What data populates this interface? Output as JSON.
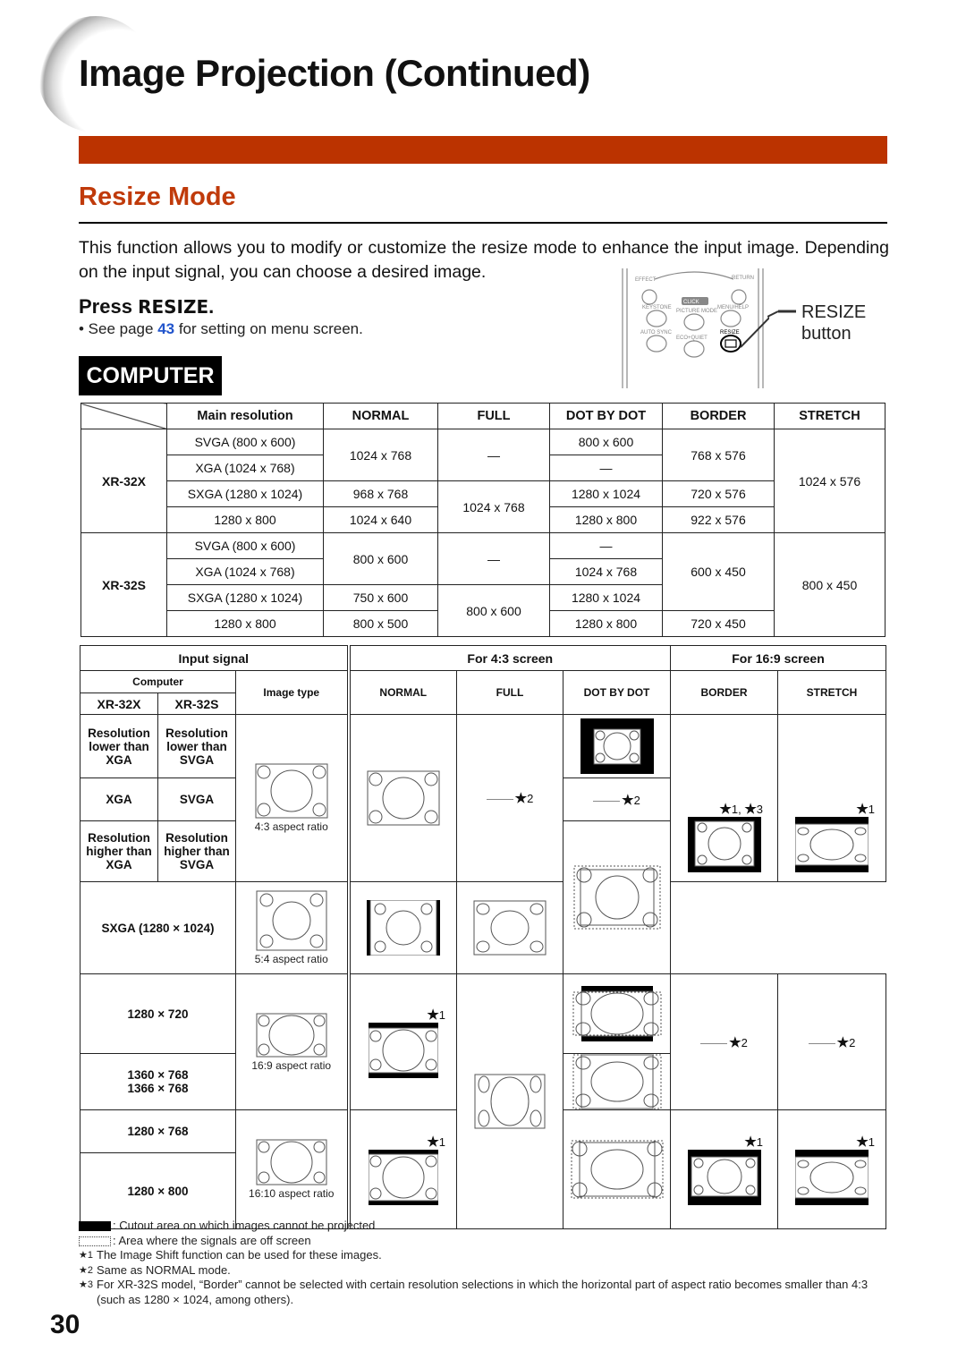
{
  "header": {
    "title": "Image Projection (Continued)",
    "accent_color": "#bb3300",
    "section_color": "#c03a0a"
  },
  "section": {
    "title": "Resize Mode",
    "intro": "This function allows you to modify or customize the resize mode to enhance the input image. Depending on the input signal, you can choose a desired image.",
    "press_prefix": "Press ",
    "press_key": "RESIZE",
    "press_suffix": ".",
    "see_prefix": "• See page ",
    "see_page": "43",
    "see_suffix": " for setting on menu screen.",
    "badge": "COMPUTER"
  },
  "remote": {
    "labels": [
      "EFFECT",
      "RETURN",
      "KEYSTONE",
      "CLICK",
      "PICTURE MODE",
      "MENU/HELP",
      "AUTO SYNC",
      "ECO+QUIET",
      "RESIZE"
    ],
    "callout_line1": "RESIZE",
    "callout_line2": "button"
  },
  "resolution_table": {
    "headers": [
      "",
      "Main resolution",
      "NORMAL",
      "FULL",
      "DOT BY DOT",
      "BORDER",
      "STRETCH"
    ],
    "groups": [
      {
        "model": "XR-32X",
        "rows": [
          {
            "main": "SVGA (800 x 600)",
            "normal": "1024 x 768",
            "full": "—",
            "dot": "800 x 600",
            "border": "768 x 576",
            "stretch": "1024 x 576"
          },
          {
            "main": "XGA (1024 x 768)",
            "normal": "1024 x 768",
            "full": "—",
            "dot": "—",
            "border": "768 x 576",
            "stretch": "1024 x 576"
          },
          {
            "main": "SXGA (1280 x 1024)",
            "normal": "968 x 768",
            "full": "1024 x 768",
            "dot": "1280 x 1024",
            "border": "720 x 576",
            "stretch": "1024 x 576"
          },
          {
            "main": "1280 x 800",
            "normal": "1024 x 640",
            "full": "1024 x 768",
            "dot": "1280 x 800",
            "border": "922 x 576",
            "stretch": "1024 x 576"
          }
        ]
      },
      {
        "model": "XR-32S",
        "rows": [
          {
            "main": "SVGA (800 x 600)",
            "normal": "800 x 600",
            "full": "—",
            "dot": "—",
            "border": "600 x 450",
            "stretch": "800 x 450"
          },
          {
            "main": "XGA (1024 x 768)",
            "normal": "800 x 600",
            "full": "—",
            "dot": "1024 x 768",
            "border": "600 x 450",
            "stretch": "800 x 450"
          },
          {
            "main": "SXGA (1280 x 1024)",
            "normal": "750 x 600",
            "full": "800 x 600",
            "dot": "1280 x 1024",
            "border": "600 x 450",
            "stretch": "800 x 450"
          },
          {
            "main": "1280 x 800",
            "normal": "800 x 500",
            "full": "800 x 600",
            "dot": "1280 x 800",
            "border": "720 x 450",
            "stretch": "800 x 450"
          }
        ]
      }
    ]
  },
  "image_table": {
    "input_signal": "Input signal",
    "computer": "Computer",
    "model_x": "XR-32X",
    "model_s": "XR-32S",
    "image_type": "Image type",
    "screen_43": "For 4:3 screen",
    "screen_169": "For 16:9 screen",
    "modes": [
      "NORMAL",
      "FULL",
      "DOT BY DOT",
      "BORDER",
      "STRETCH"
    ],
    "rows": {
      "lower_x": "Resolution lower than XGA",
      "lower_s": "Resolution lower than SVGA",
      "eq_x": "XGA",
      "eq_s": "SVGA",
      "higher_x": "Resolution higher than XGA",
      "higher_s": "Resolution higher than SVGA",
      "sxga": "SXGA (1280 × 1024)",
      "r720": "1280 × 720",
      "r1360": "1360 × 768",
      "r1366": "1366 × 768",
      "r768": "1280 × 768",
      "r800": "1280 × 800"
    },
    "captions": {
      "a43": "4:3 aspect ratio",
      "a54": "5:4 aspect ratio",
      "a169": "16:9 aspect ratio",
      "a1610": "16:10 aspect ratio"
    },
    "notes": {
      "star": "★",
      "n1": "1",
      "n2": "2",
      "n13": "1, ",
      "n3": "3"
    }
  },
  "legend": {
    "cutout": ": Cutout area on which images cannot be projected",
    "offscreen": ": Area where the signals are off screen",
    "fn1_mark": "★1",
    "fn1": "The Image Shift function can be used for these images.",
    "fn2_mark": "★2",
    "fn2": "Same as NORMAL mode.",
    "fn3_mark": "★3",
    "fn3": "For XR-32S model, “Border” cannot be selected with certain resolution selections in which the horizontal part of aspect ratio becomes smaller than 4:3 (such as 1280 × 1024, among others)."
  },
  "page_number": "30"
}
